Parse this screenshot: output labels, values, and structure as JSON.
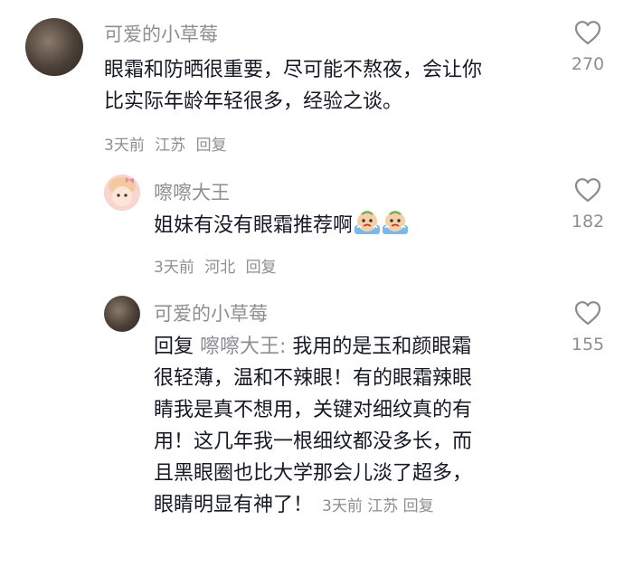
{
  "comments": [
    {
      "author": "可爱的小草莓",
      "lines": [
        "眼霜和防晒很重要，尽可能不熬夜，会让你",
        "比实际年龄年轻很多，经验之谈。"
      ],
      "time": "3天前",
      "location": "江苏",
      "reply_label": "回复",
      "likes": "270",
      "avatar_icon": "profile-photo"
    },
    {
      "author": "嚓嚓大王",
      "text": "姐妹有没有眼霜推荐啊",
      "emojis": [
        "crying-face-emoji",
        "crying-face-emoji"
      ],
      "time": "3天前",
      "location": "河北",
      "reply_label": "回复",
      "likes": "182",
      "avatar_icon": "cartoon-girl-avatar"
    },
    {
      "author": "可爱的小草莓",
      "reply_prefix": "回复",
      "reply_target": "嚓嚓大王:",
      "first_line_text": " 我用的是玉和颜眼霜",
      "lines": [
        "很轻薄，温和不辣眼！有的眼霜辣眼",
        "睛我是真不想用，关键对细纹真的有",
        "用！这几年我一根细纹都没多长，而",
        "且黑眼圈也比大学那会儿淡了超多，"
      ],
      "last_line": "眼睛明显有神了！",
      "time": "3天前",
      "location": "江苏",
      "reply_label": "回复",
      "likes": "155",
      "avatar_icon": "profile-photo"
    }
  ]
}
